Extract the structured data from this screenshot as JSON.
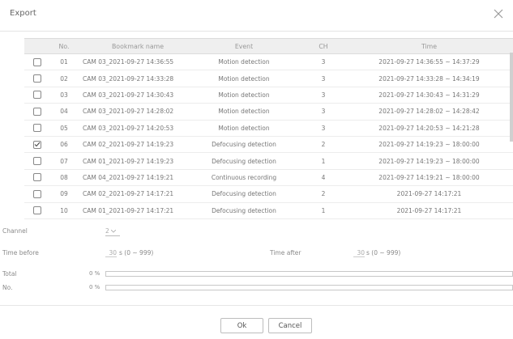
{
  "dialog": {
    "title": "Export"
  },
  "table": {
    "headers": {
      "no": "No.",
      "bookmark": "Bookmark name",
      "event": "Event",
      "ch": "CH",
      "time": "Time"
    },
    "rows": [
      {
        "checked": false,
        "no": "01",
        "bookmark": "CAM 03_2021-09-27 14:36:55",
        "event": "Motion detection",
        "ch": "3",
        "time": "2021-09-27 14:36:55 ~ 14:37:29"
      },
      {
        "checked": false,
        "no": "02",
        "bookmark": "CAM 03_2021-09-27 14:33:28",
        "event": "Motion detection",
        "ch": "3",
        "time": "2021-09-27 14:33:28 ~ 14:34:19"
      },
      {
        "checked": false,
        "no": "03",
        "bookmark": "CAM 03_2021-09-27 14:30:43",
        "event": "Motion detection",
        "ch": "3",
        "time": "2021-09-27 14:30:43 ~ 14:31:29"
      },
      {
        "checked": false,
        "no": "04",
        "bookmark": "CAM 03_2021-09-27 14:28:02",
        "event": "Motion detection",
        "ch": "3",
        "time": "2021-09-27 14:28:02 ~ 14:28:42"
      },
      {
        "checked": false,
        "no": "05",
        "bookmark": "CAM 03_2021-09-27 14:20:53",
        "event": "Motion detection",
        "ch": "3",
        "time": "2021-09-27 14:20:53 ~ 14:21:28"
      },
      {
        "checked": true,
        "no": "06",
        "bookmark": "CAM 02_2021-09-27 14:19:23",
        "event": "Defocusing detection",
        "ch": "2",
        "time": "2021-09-27 14:19:23 ~ 18:00:00"
      },
      {
        "checked": false,
        "no": "07",
        "bookmark": "CAM 01_2021-09-27 14:19:23",
        "event": "Defocusing detection",
        "ch": "1",
        "time": "2021-09-27 14:19:23 ~ 18:00:00"
      },
      {
        "checked": false,
        "no": "08",
        "bookmark": "CAM 04_2021-09-27 14:19:21",
        "event": "Continuous recording",
        "ch": "4",
        "time": "2021-09-27 14:19:21 ~ 18:00:00"
      },
      {
        "checked": false,
        "no": "09",
        "bookmark": "CAM 02_2021-09-27 14:17:21",
        "event": "Defocusing detection",
        "ch": "2",
        "time": "2021-09-27 14:17:21"
      },
      {
        "checked": false,
        "no": "10",
        "bookmark": "CAM 01_2021-09-27 14:17:21",
        "event": "Defocusing detection",
        "ch": "1",
        "time": "2021-09-27 14:17:21"
      }
    ]
  },
  "form": {
    "channel_label": "Channel",
    "channel_value": "2",
    "time_before_label": "Time before",
    "time_before_value": "30",
    "time_before_range": "s (0 ~ 999)",
    "time_after_label": "Time after",
    "time_after_value": "30",
    "time_after_range": "s (0 ~ 999)"
  },
  "progress": {
    "total_label": "Total",
    "total_pct": "0 %",
    "total_value": 0,
    "no_label": "No.",
    "no_pct": "0 %",
    "no_value": 0
  },
  "buttons": {
    "ok": "Ok",
    "cancel": "Cancel"
  },
  "colors": {
    "checkbox_border": "#888888",
    "header_bg": "#efefef",
    "accent": "#555555"
  }
}
